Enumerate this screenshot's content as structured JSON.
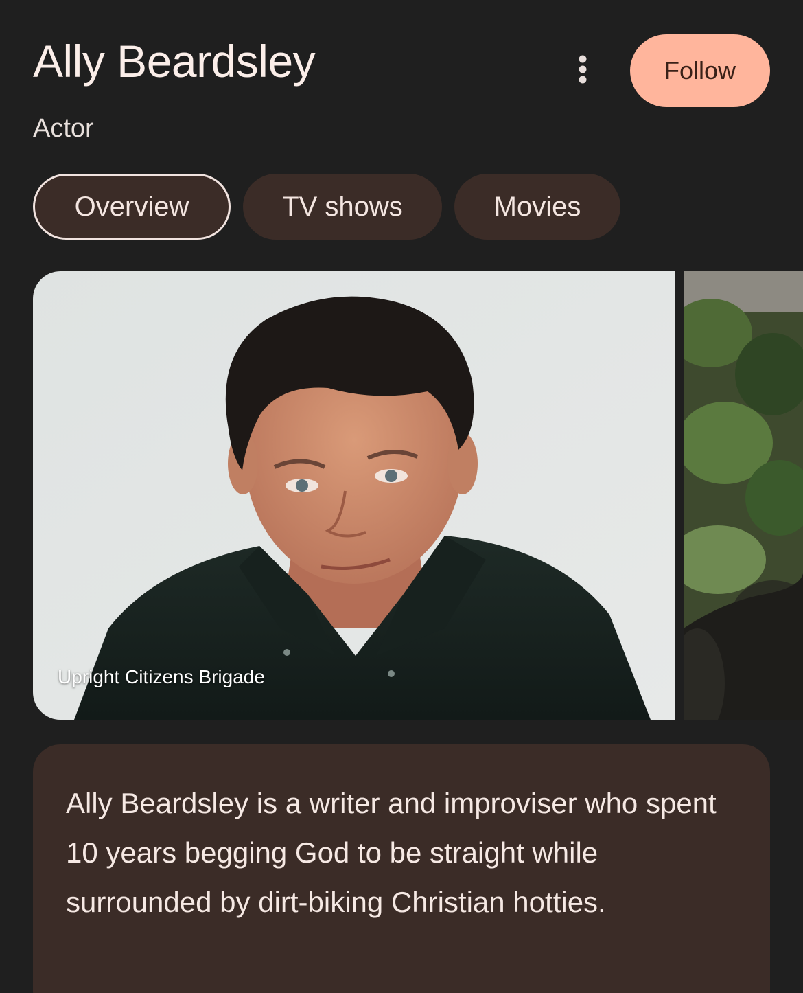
{
  "header": {
    "title": "Ally Beardsley",
    "subtitle": "Actor",
    "follow_label": "Follow",
    "more_icon": "more-vert-icon"
  },
  "tabs": [
    {
      "label": "Overview",
      "active": true
    },
    {
      "label": "TV shows",
      "active": false
    },
    {
      "label": "Movies",
      "active": false
    }
  ],
  "images": {
    "main_caption": "Upright Citizens Brigade"
  },
  "description": {
    "text": "Ally Beardsley is a writer and improviser who spent 10 years begging God to be straight while surrounded by dirt-biking Christian hotties."
  },
  "colors": {
    "background": "#1f1f1f",
    "accent": "#ffb59c",
    "chip": "#3b2c27",
    "text": "#fbeee9"
  }
}
